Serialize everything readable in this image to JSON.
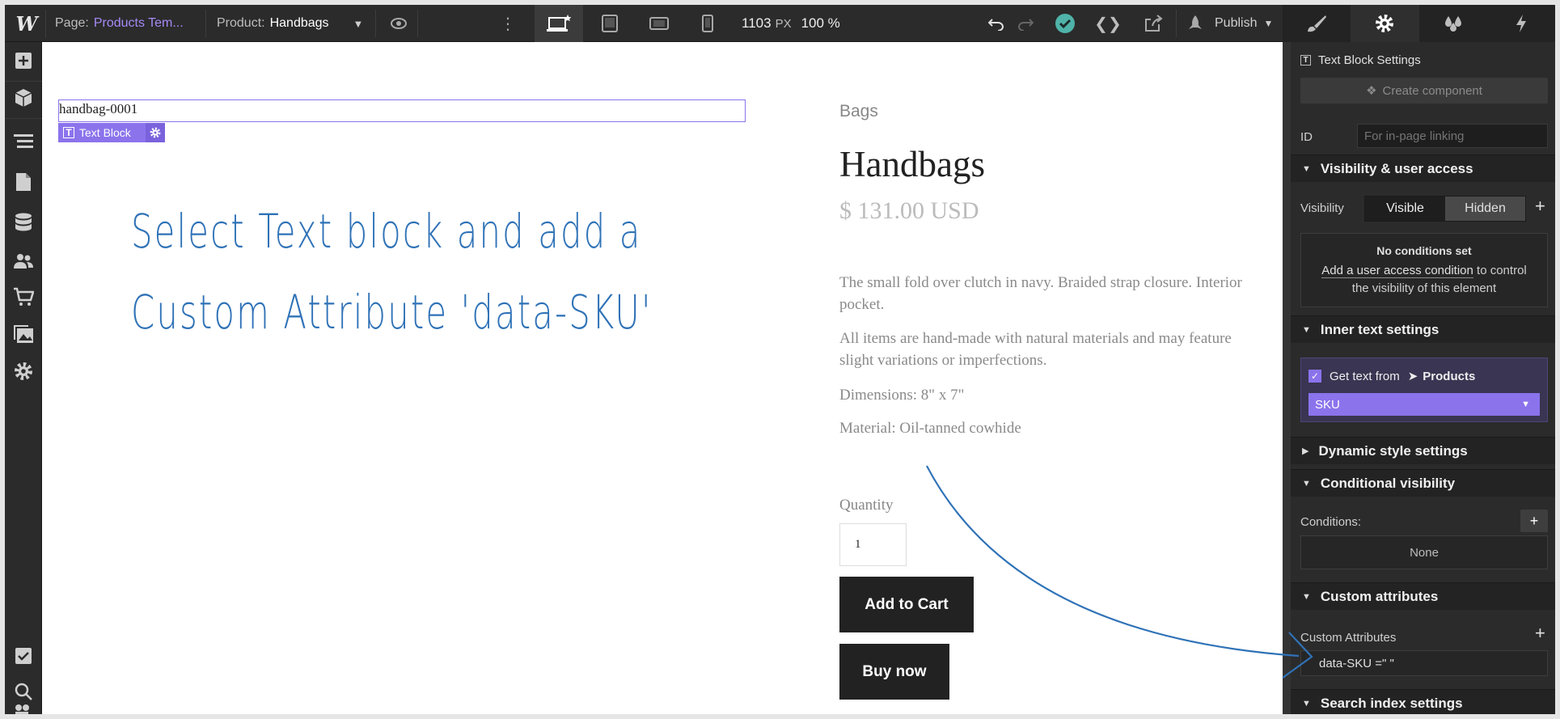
{
  "topbar": {
    "logo": "W",
    "page_label": "Page:",
    "page_name": "Products Tem...",
    "product_label": "Product:",
    "product_name": "Handbags",
    "width_value": "1103",
    "width_unit": "PX",
    "zoom_value": "100 %",
    "publish_label": "Publish"
  },
  "canvas": {
    "selected_text": "handbag-0001",
    "selected_tag": "Text Block",
    "annotation_line1": "Select Text block and add a",
    "annotation_line2": "Custom Attribute 'data-SKU'",
    "category": "Bags",
    "title": "Handbags",
    "price": "$ 131.00 USD",
    "description_1": "The small fold over clutch in navy. Braided strap closure. Interior pocket.",
    "description_2": "All items are hand-made with natural materials and may feature slight variations or imperfections.",
    "dimensions": "Dimensions: 8\" x 7\"",
    "material": "Material: Oil-tanned cowhide",
    "quantity_label": "Quantity",
    "quantity_value": "1",
    "add_to_cart": "Add to Cart",
    "buy_now": "Buy now"
  },
  "panel": {
    "header": "Text Block Settings",
    "create_component": "Create component",
    "id_label": "ID",
    "id_placeholder": "For in-page linking",
    "visibility_section": "Visibility & user access",
    "visibility_label": "Visibility",
    "visible": "Visible",
    "hidden": "Hidden",
    "no_conditions": "No conditions set",
    "condition_link": "Add a user access condition",
    "condition_rest1": " to control",
    "condition_rest2": "the visibility of this element",
    "inner_text_section": "Inner text settings",
    "get_text_from": "Get text from",
    "collection": "Products",
    "field": "SKU",
    "dynamic_style_section": "Dynamic style settings",
    "conditional_visibility_section": "Conditional visibility",
    "conditions_label": "Conditions:",
    "conditions_value": "None",
    "custom_attributes_section": "Custom attributes",
    "custom_attributes_label": "Custom Attributes",
    "attribute_entry": "data-SKU =\" \"",
    "search_index_section": "Search index settings"
  },
  "colors": {
    "accent": "#8b73ec",
    "annotation": "#2f72b7",
    "publish_ok": "#4fb3a9"
  }
}
